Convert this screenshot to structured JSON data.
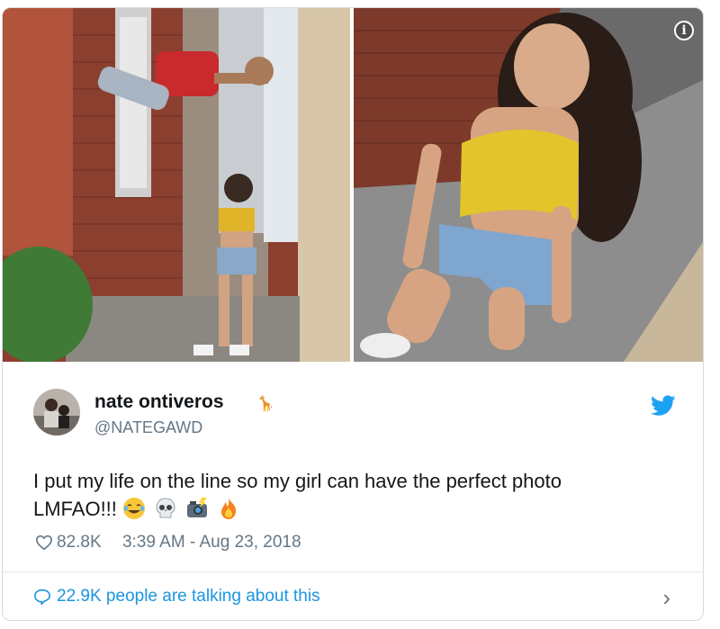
{
  "author": {
    "name": "nate ontiveros",
    "handle": "@NATEGAWD",
    "badge": "🦒"
  },
  "tweet": {
    "text": "I put my life on the line so my girl can have the perfect photo",
    "text_line2": "LMFAO!!!",
    "emojis": [
      "joy-emoji",
      "skull-emoji",
      "camera-flash-emoji",
      "fire-emoji"
    ]
  },
  "meta": {
    "likes": "82.8K",
    "timestamp": "3:39 AM - Aug 23, 2018"
  },
  "footer": {
    "talking": "22.9K people are talking about this"
  },
  "icons": {
    "info": "i",
    "chevron": "›"
  },
  "colors": {
    "twitter_blue": "#1da1f2",
    "link_blue": "#1b95e0",
    "text": "#14171a",
    "muted": "#657786"
  }
}
